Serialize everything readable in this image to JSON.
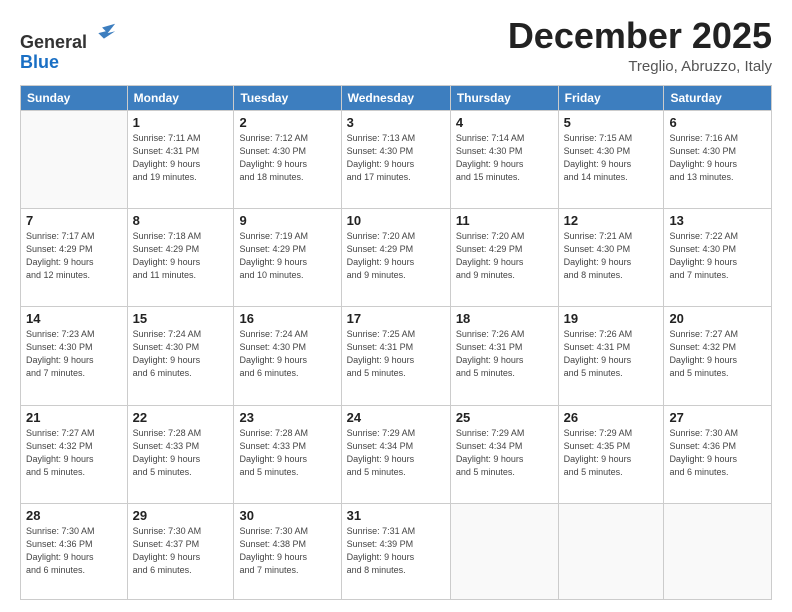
{
  "header": {
    "logo_line1": "General",
    "logo_line2": "Blue",
    "month": "December 2025",
    "location": "Treglio, Abruzzo, Italy"
  },
  "weekdays": [
    "Sunday",
    "Monday",
    "Tuesday",
    "Wednesday",
    "Thursday",
    "Friday",
    "Saturday"
  ],
  "weeks": [
    [
      {
        "day": "",
        "info": ""
      },
      {
        "day": "1",
        "info": "Sunrise: 7:11 AM\nSunset: 4:31 PM\nDaylight: 9 hours\nand 19 minutes."
      },
      {
        "day": "2",
        "info": "Sunrise: 7:12 AM\nSunset: 4:30 PM\nDaylight: 9 hours\nand 18 minutes."
      },
      {
        "day": "3",
        "info": "Sunrise: 7:13 AM\nSunset: 4:30 PM\nDaylight: 9 hours\nand 17 minutes."
      },
      {
        "day": "4",
        "info": "Sunrise: 7:14 AM\nSunset: 4:30 PM\nDaylight: 9 hours\nand 15 minutes."
      },
      {
        "day": "5",
        "info": "Sunrise: 7:15 AM\nSunset: 4:30 PM\nDaylight: 9 hours\nand 14 minutes."
      },
      {
        "day": "6",
        "info": "Sunrise: 7:16 AM\nSunset: 4:30 PM\nDaylight: 9 hours\nand 13 minutes."
      }
    ],
    [
      {
        "day": "7",
        "info": "Sunrise: 7:17 AM\nSunset: 4:29 PM\nDaylight: 9 hours\nand 12 minutes."
      },
      {
        "day": "8",
        "info": "Sunrise: 7:18 AM\nSunset: 4:29 PM\nDaylight: 9 hours\nand 11 minutes."
      },
      {
        "day": "9",
        "info": "Sunrise: 7:19 AM\nSunset: 4:29 PM\nDaylight: 9 hours\nand 10 minutes."
      },
      {
        "day": "10",
        "info": "Sunrise: 7:20 AM\nSunset: 4:29 PM\nDaylight: 9 hours\nand 9 minutes."
      },
      {
        "day": "11",
        "info": "Sunrise: 7:20 AM\nSunset: 4:29 PM\nDaylight: 9 hours\nand 9 minutes."
      },
      {
        "day": "12",
        "info": "Sunrise: 7:21 AM\nSunset: 4:30 PM\nDaylight: 9 hours\nand 8 minutes."
      },
      {
        "day": "13",
        "info": "Sunrise: 7:22 AM\nSunset: 4:30 PM\nDaylight: 9 hours\nand 7 minutes."
      }
    ],
    [
      {
        "day": "14",
        "info": "Sunrise: 7:23 AM\nSunset: 4:30 PM\nDaylight: 9 hours\nand 7 minutes."
      },
      {
        "day": "15",
        "info": "Sunrise: 7:24 AM\nSunset: 4:30 PM\nDaylight: 9 hours\nand 6 minutes."
      },
      {
        "day": "16",
        "info": "Sunrise: 7:24 AM\nSunset: 4:30 PM\nDaylight: 9 hours\nand 6 minutes."
      },
      {
        "day": "17",
        "info": "Sunrise: 7:25 AM\nSunset: 4:31 PM\nDaylight: 9 hours\nand 5 minutes."
      },
      {
        "day": "18",
        "info": "Sunrise: 7:26 AM\nSunset: 4:31 PM\nDaylight: 9 hours\nand 5 minutes."
      },
      {
        "day": "19",
        "info": "Sunrise: 7:26 AM\nSunset: 4:31 PM\nDaylight: 9 hours\nand 5 minutes."
      },
      {
        "day": "20",
        "info": "Sunrise: 7:27 AM\nSunset: 4:32 PM\nDaylight: 9 hours\nand 5 minutes."
      }
    ],
    [
      {
        "day": "21",
        "info": "Sunrise: 7:27 AM\nSunset: 4:32 PM\nDaylight: 9 hours\nand 5 minutes."
      },
      {
        "day": "22",
        "info": "Sunrise: 7:28 AM\nSunset: 4:33 PM\nDaylight: 9 hours\nand 5 minutes."
      },
      {
        "day": "23",
        "info": "Sunrise: 7:28 AM\nSunset: 4:33 PM\nDaylight: 9 hours\nand 5 minutes."
      },
      {
        "day": "24",
        "info": "Sunrise: 7:29 AM\nSunset: 4:34 PM\nDaylight: 9 hours\nand 5 minutes."
      },
      {
        "day": "25",
        "info": "Sunrise: 7:29 AM\nSunset: 4:34 PM\nDaylight: 9 hours\nand 5 minutes."
      },
      {
        "day": "26",
        "info": "Sunrise: 7:29 AM\nSunset: 4:35 PM\nDaylight: 9 hours\nand 5 minutes."
      },
      {
        "day": "27",
        "info": "Sunrise: 7:30 AM\nSunset: 4:36 PM\nDaylight: 9 hours\nand 6 minutes."
      }
    ],
    [
      {
        "day": "28",
        "info": "Sunrise: 7:30 AM\nSunset: 4:36 PM\nDaylight: 9 hours\nand 6 minutes."
      },
      {
        "day": "29",
        "info": "Sunrise: 7:30 AM\nSunset: 4:37 PM\nDaylight: 9 hours\nand 6 minutes."
      },
      {
        "day": "30",
        "info": "Sunrise: 7:30 AM\nSunset: 4:38 PM\nDaylight: 9 hours\nand 7 minutes."
      },
      {
        "day": "31",
        "info": "Sunrise: 7:31 AM\nSunset: 4:39 PM\nDaylight: 9 hours\nand 8 minutes."
      },
      {
        "day": "",
        "info": ""
      },
      {
        "day": "",
        "info": ""
      },
      {
        "day": "",
        "info": ""
      }
    ]
  ]
}
